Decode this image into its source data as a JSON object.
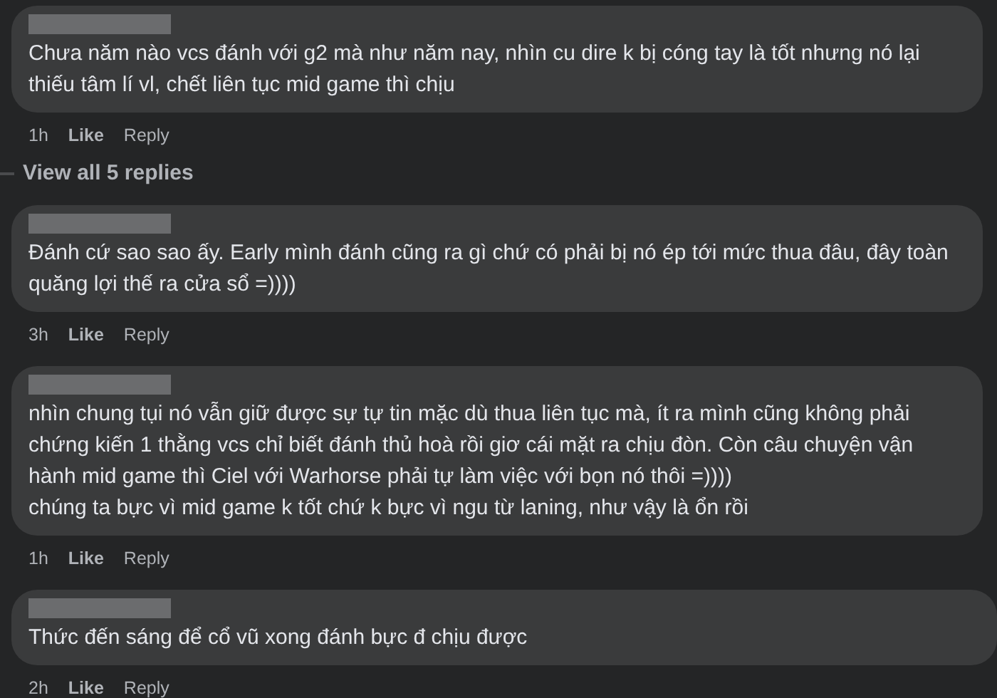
{
  "comments": [
    {
      "text": "Chưa năm nào vcs đánh với g2 mà như năm nay, nhìn cu dire k bị cóng tay là tốt nhưng nó lại thiếu tâm lí vl, chết liên tục mid game thì chịu",
      "time": "1h",
      "like": "Like",
      "reply": "Reply",
      "view_replies": "View all 5 replies"
    },
    {
      "text": "Đánh cứ sao sao ấy. Early mình đánh cũng ra gì chứ có phải bị nó ép tới mức thua đâu, đây toàn quăng lợi thế ra cửa sổ =))))",
      "time": "3h",
      "like": "Like",
      "reply": "Reply"
    },
    {
      "text": "nhìn chung tụi nó vẫn giữ được sự tự tin mặc dù thua liên tục mà, ít ra mình cũng không phải chứng kiến 1 thằng vcs chỉ biết đánh thủ hoà rồi giơ cái mặt ra chịu đòn. Còn câu chuyện vận hành mid game thì Ciel với Warhorse phải tự làm việc với bọn nó thôi =))))\nchúng ta bực vì mid game k tốt chứ k bực vì ngu từ laning, như vậy là ổn rồi",
      "time": "1h",
      "like": "Like",
      "reply": "Reply"
    },
    {
      "text": "Thức đến sáng để cổ vũ xong đánh bực đ chịu được",
      "time": "2h",
      "like": "Like",
      "reply": "Reply"
    }
  ]
}
